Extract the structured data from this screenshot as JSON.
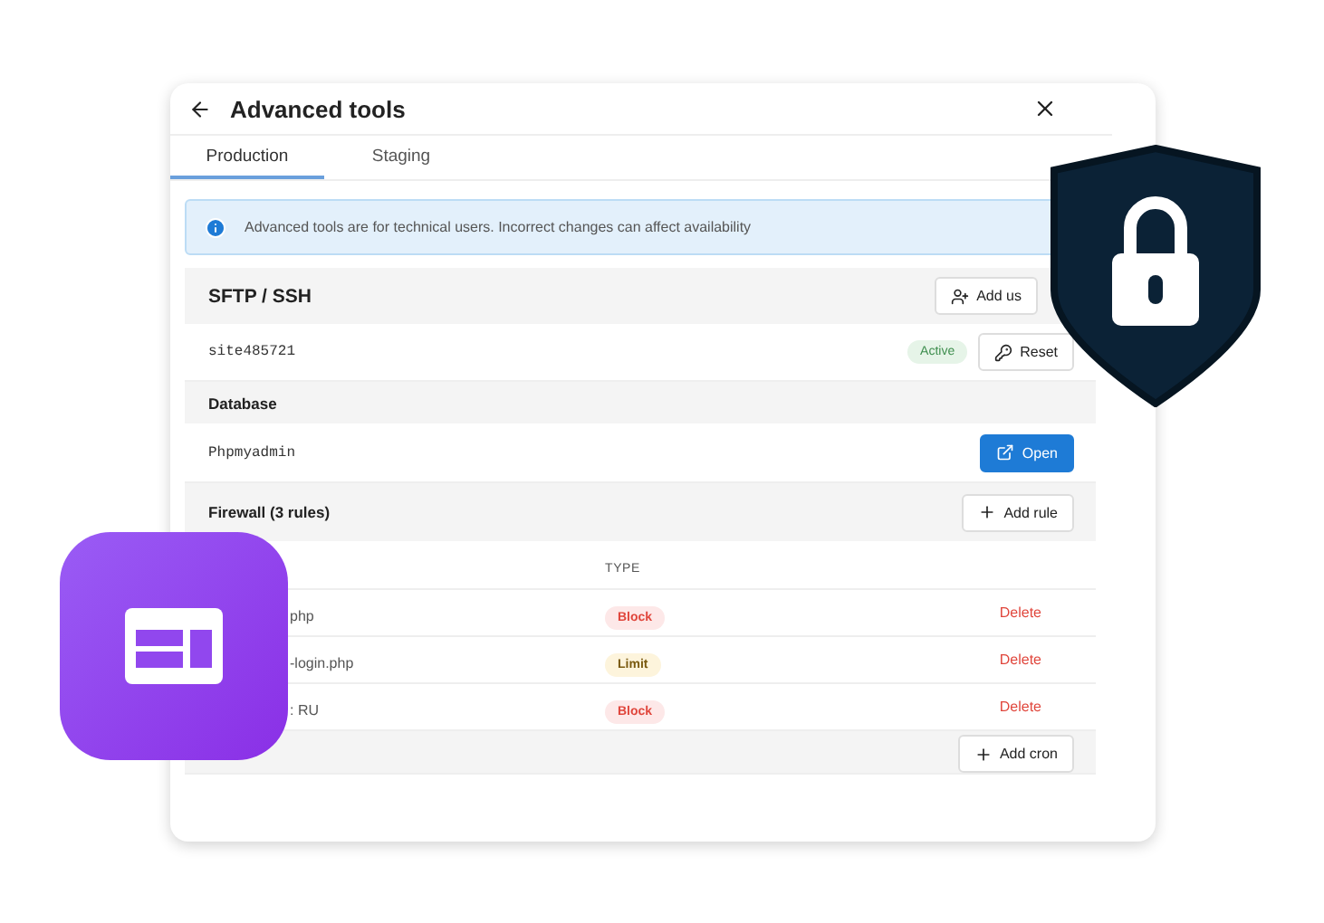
{
  "header": {
    "title": "Advanced tools"
  },
  "tabs": [
    {
      "label": "Production",
      "selected": true
    },
    {
      "label": "Staging",
      "selected": false
    }
  ],
  "notice": "Advanced tools are for technical users. Incorrect changes can affect availability",
  "sftp": {
    "title": "SFTP / SSH",
    "add_button": "Add us",
    "user": "site485721",
    "status": "Active",
    "reset_button": "Reset"
  },
  "database": {
    "title": "Database",
    "name": "Phpmyadmin",
    "open_button": "Open"
  },
  "firewall": {
    "title": "Firewall (3 rules)",
    "add_button": "Add rule",
    "type_column": "TYPE",
    "rules": [
      {
        "target": "php",
        "type": "Block",
        "kind": "block",
        "action": "Delete"
      },
      {
        "target": "-login.php",
        "type": "Limit",
        "kind": "limit",
        "action": "Delete"
      },
      {
        "target": ": RU",
        "type": "Block",
        "kind": "block",
        "action": "Delete"
      }
    ]
  },
  "cron": {
    "add_button": "Add cron"
  }
}
